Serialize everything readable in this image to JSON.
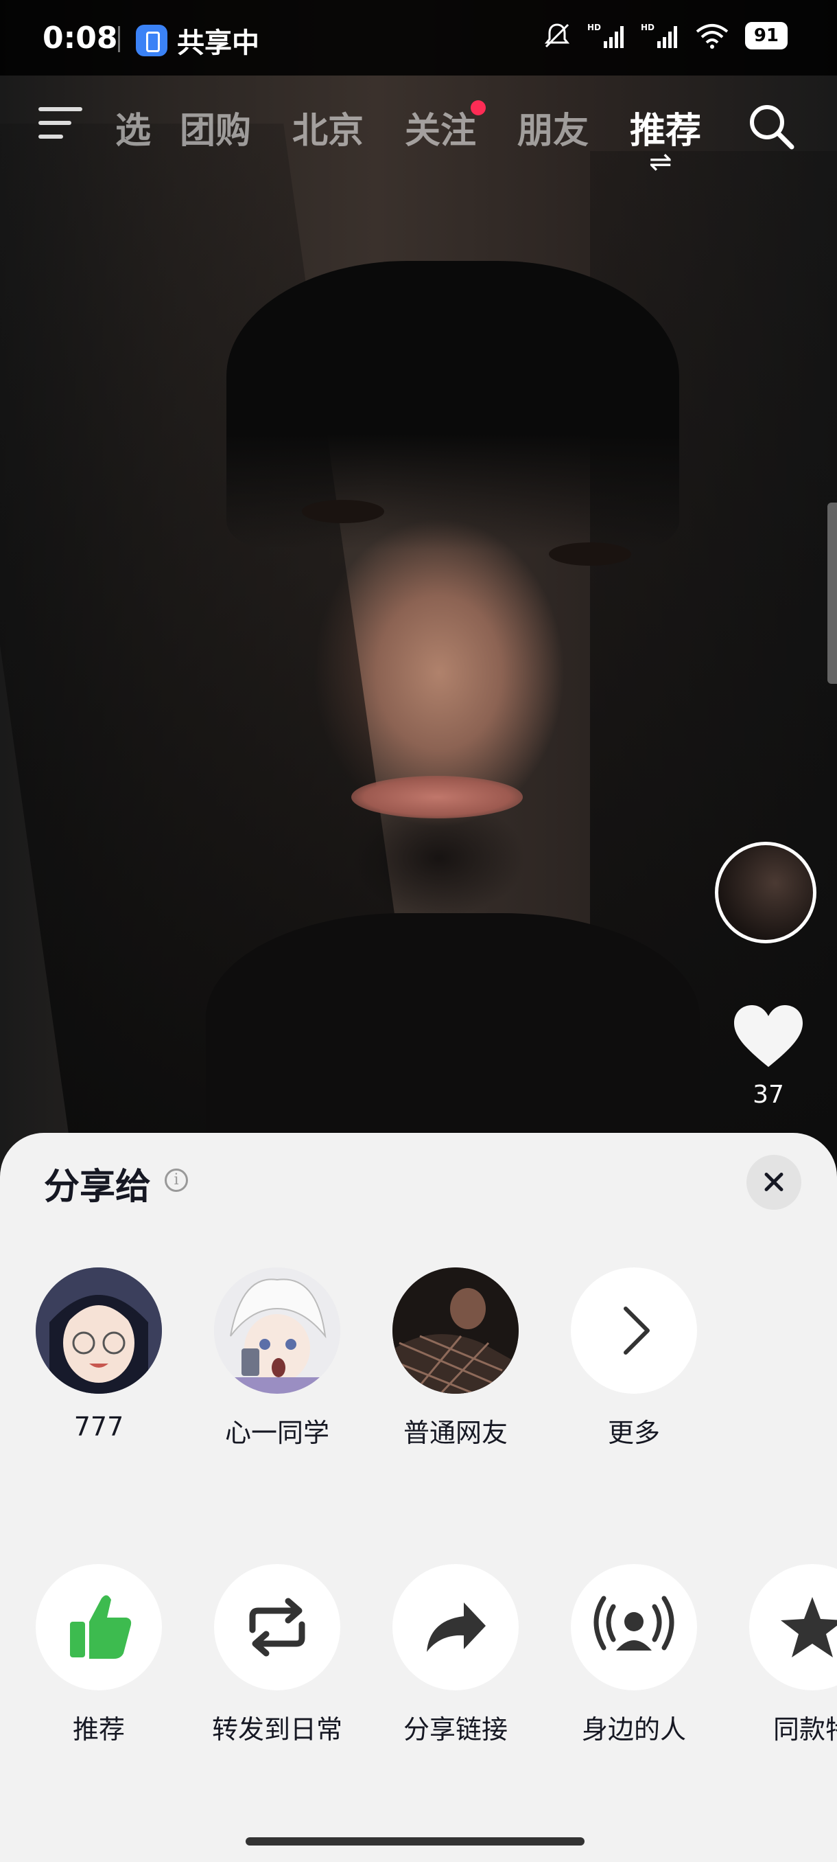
{
  "status_bar": {
    "time": "0:08",
    "share_status": "共享中",
    "battery": "91"
  },
  "top_nav": {
    "tabs": [
      {
        "label": "选",
        "active": false
      },
      {
        "label": "团购",
        "active": false
      },
      {
        "label": "北京",
        "active": false
      },
      {
        "label": "关注",
        "active": false,
        "badge": true
      },
      {
        "label": "朋友",
        "active": false
      },
      {
        "label": "推荐",
        "active": true
      }
    ],
    "swap_glyph": "⇌",
    "icons": [
      "menu-icon",
      "search-icon"
    ]
  },
  "video": {
    "like_count": "37",
    "icons": [
      "creator-avatar",
      "heart-icon"
    ]
  },
  "share_sheet": {
    "title": "分享给",
    "info_glyph": "i",
    "contacts": [
      {
        "name": "777"
      },
      {
        "name": "心一同学"
      },
      {
        "name": "普通网友"
      },
      {
        "name": "更多"
      }
    ],
    "actions": [
      {
        "label": "推荐",
        "icon": "thumbs-up-icon"
      },
      {
        "label": "转发到日常",
        "icon": "repost-icon"
      },
      {
        "label": "分享链接",
        "icon": "share-arrow-icon"
      },
      {
        "label": "身边的人",
        "icon": "nearby-people-icon"
      },
      {
        "label": "同款特",
        "icon": "effect-star-icon"
      }
    ]
  },
  "colors": {
    "accent_red": "#fe2c55",
    "recommend_green": "#3dbb4f",
    "sheet_bg": "#f2f2f2"
  }
}
